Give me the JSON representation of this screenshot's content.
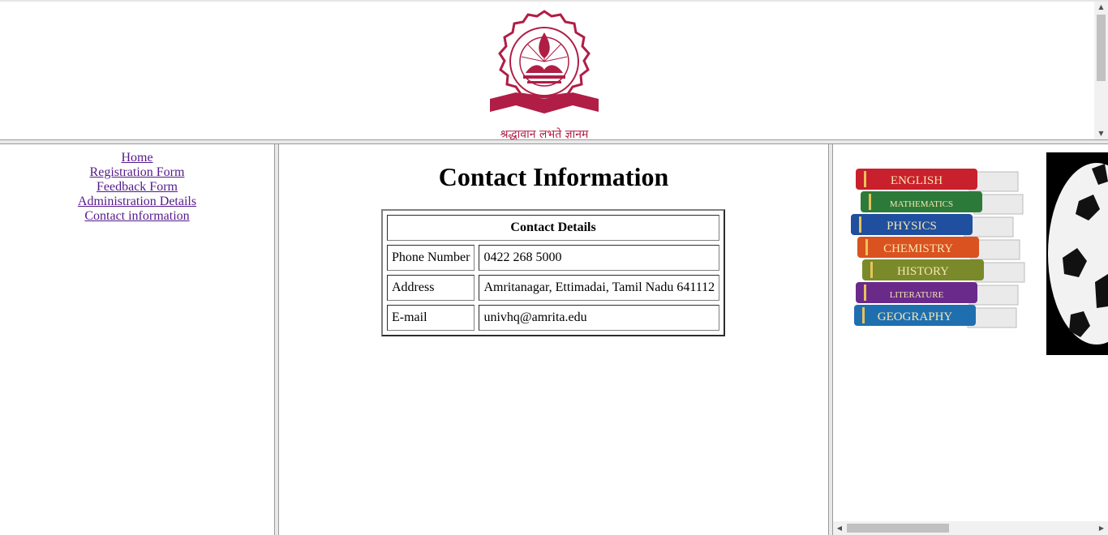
{
  "header": {
    "logo_icon": "amrita-university-seal-icon",
    "logo_motto": "श्रद्धावान लभते ज्ञानम"
  },
  "nav": {
    "items": [
      {
        "label": "Home"
      },
      {
        "label": "Registration Form"
      },
      {
        "label": "Feedback Form"
      },
      {
        "label": "Administration Details"
      },
      {
        "label": "Contact information"
      }
    ]
  },
  "main": {
    "title": "Contact Information",
    "table": {
      "header": "Contact Details",
      "rows": [
        {
          "label": "Phone Number",
          "value": "0422 268 5000"
        },
        {
          "label": "Address",
          "value": "Amritanagar, Ettimadai, Tamil Nadu 641112"
        },
        {
          "label": "E-mail",
          "value": "univhq@amrita.edu"
        }
      ]
    }
  },
  "right": {
    "books": [
      "ENGLISH",
      "MATHEMATICS",
      "PHYSICS",
      "CHEMISTRY",
      "HISTORY",
      "LITERATURE",
      "GEOGRAPHY"
    ],
    "book_colors": [
      "#c8202c",
      "#2c7a3a",
      "#1f4f9e",
      "#d9521f",
      "#7a8a2a",
      "#6a2a8a",
      "#1f6fb0"
    ]
  },
  "colors": {
    "link": "#551a8b",
    "seal": "#b01e45"
  }
}
